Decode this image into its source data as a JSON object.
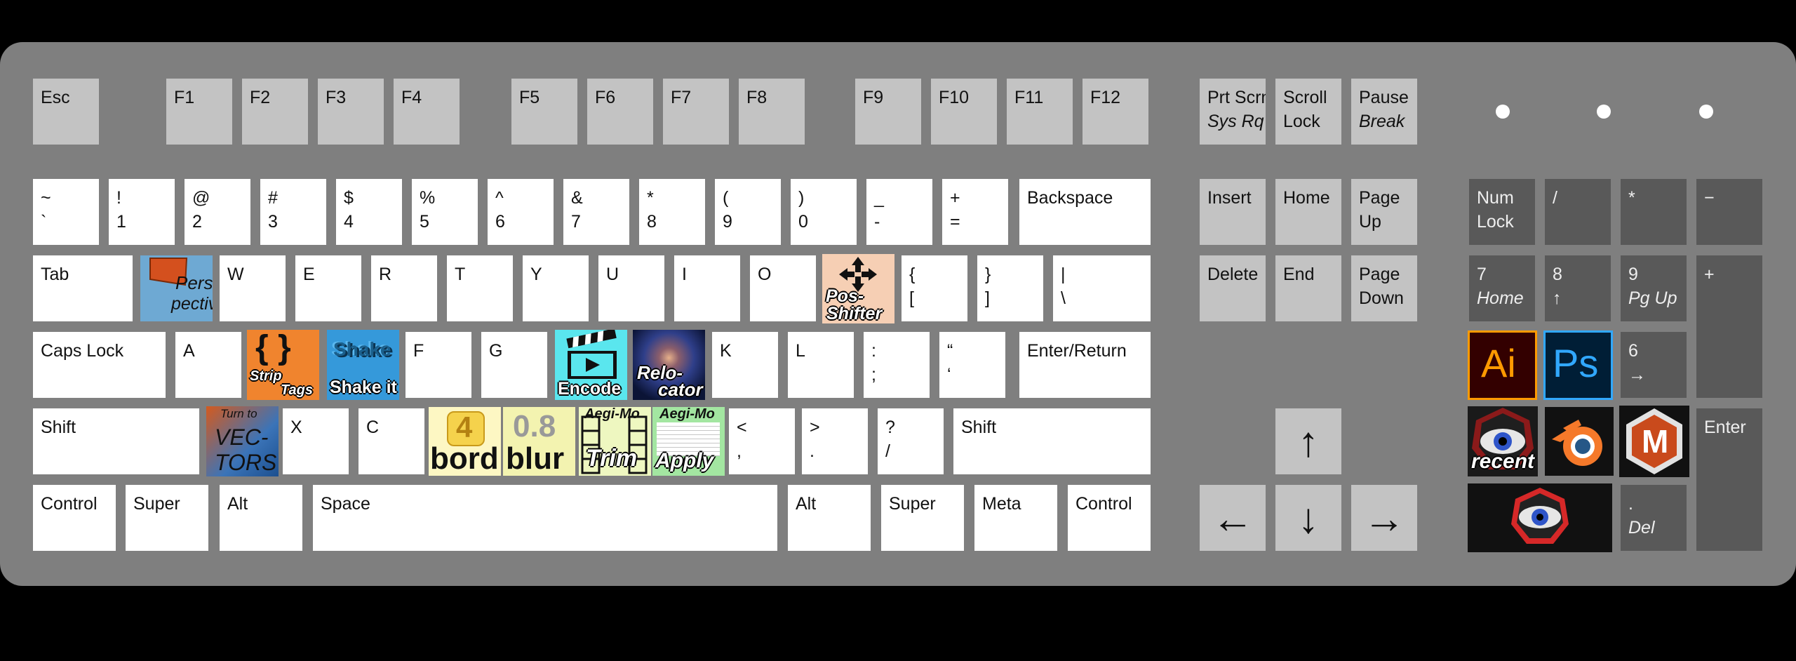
{
  "keyboard": {
    "esc": "Esc",
    "f1": "F1",
    "f2": "F2",
    "f3": "F3",
    "f4": "F4",
    "f5": "F5",
    "f6": "F6",
    "f7": "F7",
    "f8": "F8",
    "f9": "F9",
    "f10": "F10",
    "f11": "F11",
    "f12": "F12",
    "prtscrn": "Prt Scrn",
    "sysrq": "Sys Rq",
    "scroll": "Scroll",
    "lock": "Lock",
    "pause": "Pause",
    "break": "Break",
    "tilde": "~",
    "backtick": "`",
    "excl": "!",
    "d1": "1",
    "at": "@",
    "d2": "2",
    "hash": "#",
    "d3": "3",
    "dollar": "$",
    "d4": "4",
    "pct": "%",
    "d5": "5",
    "caret": "^",
    "d6": "6",
    "amp": "&",
    "d7": "7",
    "star": "*",
    "d8": "8",
    "lpar": "(",
    "d9": "9",
    "rpar": ")",
    "d0": "0",
    "under": "_",
    "minus": "-",
    "plus": "+",
    "eq": "=",
    "backspace": "Backspace",
    "tab": "Tab",
    "w": "W",
    "e": "E",
    "r": "R",
    "t": "T",
    "y": "Y",
    "u": "U",
    "i": "I",
    "o": "O",
    "lbrace": "{",
    "lbrack": "[",
    "rbrace": "}",
    "rbrack": "]",
    "pipe": "|",
    "bslash": "\\",
    "capslock": "Caps Lock",
    "a": "A",
    "f": "F",
    "g": "G",
    "k": "K",
    "l": "L",
    "colon": ":",
    "semi": ";",
    "dquote": "“",
    "squote": "‘",
    "enterreturn": "Enter/Return",
    "shift": "Shift",
    "x": "X",
    "c": "C",
    "lt": "<",
    "comma": ",",
    "gt": ">",
    "period": ".",
    "qmark": "?",
    "slash": "/",
    "control": "Control",
    "super": "Super",
    "alt": "Alt",
    "space": "Space",
    "meta": "Meta",
    "insert": "Insert",
    "home": "Home",
    "pageup1": "Page",
    "pageup2": "Up",
    "delete": "Delete",
    "end": "End",
    "pagedown1": "Page",
    "pagedown2": "Down",
    "up": "↑",
    "down": "↓",
    "left": "←",
    "right": "→",
    "numlock1": "Num",
    "numlock2": "Lock",
    "npslash": "/",
    "npstar": "*",
    "npminus": "−",
    "npplus": "+",
    "np7": "7",
    "np7b": "Home",
    "np8": "8",
    "np8b": "↑",
    "np9": "9",
    "np9b": "Pg Up",
    "np6": "6",
    "np6b": "→",
    "npenter": "Enter",
    "npdot": ".",
    "npdel": "Del"
  },
  "macros": {
    "perspective": [
      "Pers-",
      "pective"
    ],
    "strip_tags": [
      "{ }",
      "Strip",
      "Tags"
    ],
    "shake": [
      "Shake",
      "Shake it"
    ],
    "encode": "Encode",
    "relocator": [
      "Relo-",
      "cator"
    ],
    "pos_shifter": [
      "Pos-",
      "Shifter"
    ],
    "vectors": [
      "Turn to",
      "VEC-",
      "TORS"
    ],
    "bord": [
      "4",
      "bord"
    ],
    "blur": [
      "0.8",
      "blur"
    ],
    "trim": [
      "Aegi-Mo",
      "Trim"
    ],
    "apply": [
      "Aegi-Mo",
      "Apply"
    ],
    "ai": "Ai",
    "ps": "Ps",
    "recent": "recent",
    "m": "M"
  },
  "colors": {
    "case": "#7f7f7f",
    "white_key": "#ffffff",
    "grey_key": "#c3c3c3",
    "dark_key": "#595959",
    "illustrator_bg": "#330000",
    "illustrator_fg": "#ff9a00",
    "photoshop_bg": "#001e36",
    "photoshop_fg": "#31a8ff",
    "blender_orange": "#f5792a",
    "blender_blue": "#265787"
  }
}
